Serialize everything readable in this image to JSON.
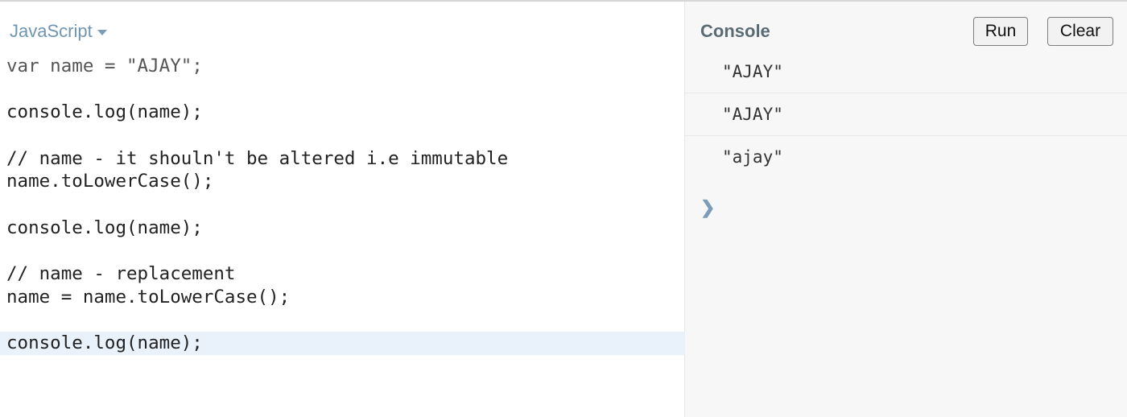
{
  "editor": {
    "language": "JavaScript",
    "lines": [
      "var name = \"AJAY\";",
      "",
      "console.log(name);",
      "",
      "// name - it shouln't be altered i.e immutable",
      "name.toLowerCase();",
      "",
      "console.log(name);",
      "",
      "// name - replacement",
      "name = name.toLowerCase();",
      "",
      "console.log(name);"
    ],
    "active_line": 13
  },
  "console": {
    "title": "Console",
    "run_label": "Run",
    "clear_label": "Clear",
    "output": [
      "\"AJAY\"",
      "\"AJAY\"",
      "\"ajay\""
    ],
    "prompt_symbol": "❯"
  },
  "colors": {
    "accent": "#6f95b3",
    "active_line_bg": "#e9f1fa",
    "console_bg": "#f7f7f7"
  }
}
